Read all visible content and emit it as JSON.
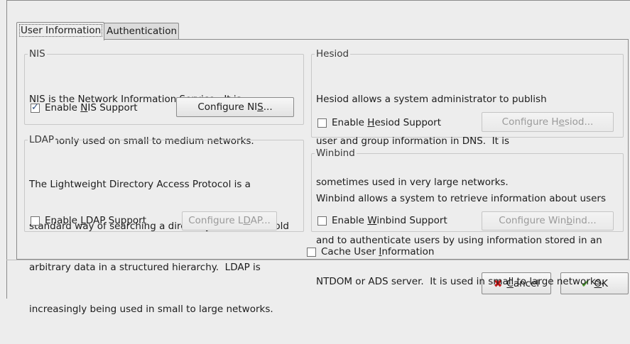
{
  "tabs": [
    {
      "label": "User Information",
      "active": true
    },
    {
      "label": "Authentication",
      "active": false
    }
  ],
  "nis": {
    "title": "NIS",
    "lines": [
      "NIS is the Network Information Service.  It is",
      "commonly used on small to medium networks."
    ],
    "enable_pre": "Enable ",
    "enable_key": "N",
    "enable_post": "IS Support",
    "checked": true,
    "configure_pre": "Configure NI",
    "configure_key": "S",
    "configure_post": "...",
    "configure_enabled": true
  },
  "hesiod": {
    "title": "Hesiod",
    "lines": [
      "Hesiod allows a system administrator to publish",
      "user and group information in DNS.  It is",
      "sometimes used in very large networks."
    ],
    "enable_pre": "Enable ",
    "enable_key": "H",
    "enable_post": "esiod Support",
    "checked": false,
    "configure_pre": "Configure H",
    "configure_key": "e",
    "configure_post": "siod...",
    "configure_enabled": false
  },
  "ldap": {
    "title": "LDAP",
    "lines": [
      "The Lightweight Directory Access Protocol is a",
      "standard way of searching a directory, which can hold",
      "arbitrary data in a structured hierarchy.  LDAP is",
      "increasingly being used in small to large networks."
    ],
    "enable_pre": "Enable ",
    "enable_key": "L",
    "enable_post": "DAP Support",
    "checked": false,
    "configure_pre": "Configure L",
    "configure_key": "D",
    "configure_post": "AP...",
    "configure_enabled": false
  },
  "winbind": {
    "title": "Winbind",
    "lines": [
      "Winbind allows a system to retrieve information about users",
      "and to authenticate users by using information stored in an",
      "NTDOM or ADS server.  It is used in small to large networks."
    ],
    "enable_pre": "Enable ",
    "enable_key": "W",
    "enable_post": "inbind Support",
    "checked": false,
    "configure_pre": "Configure Win",
    "configure_key": "b",
    "configure_post": "ind...",
    "configure_enabled": false
  },
  "cache": {
    "pre": "Cache User ",
    "key": "I",
    "post": "nformation",
    "checked": false
  },
  "buttons": {
    "cancel_pre": "",
    "cancel_key": "C",
    "cancel_post": "ancel",
    "ok_pre": "",
    "ok_key": "O",
    "ok_post": "K",
    "cancel_icon": "red-x-icon",
    "ok_icon": "green-checkmark-icon"
  },
  "colors": {
    "cancel_icon": "#c01b1b",
    "ok_icon": "#4a9a2e",
    "check_mark": "#2c4d80"
  }
}
